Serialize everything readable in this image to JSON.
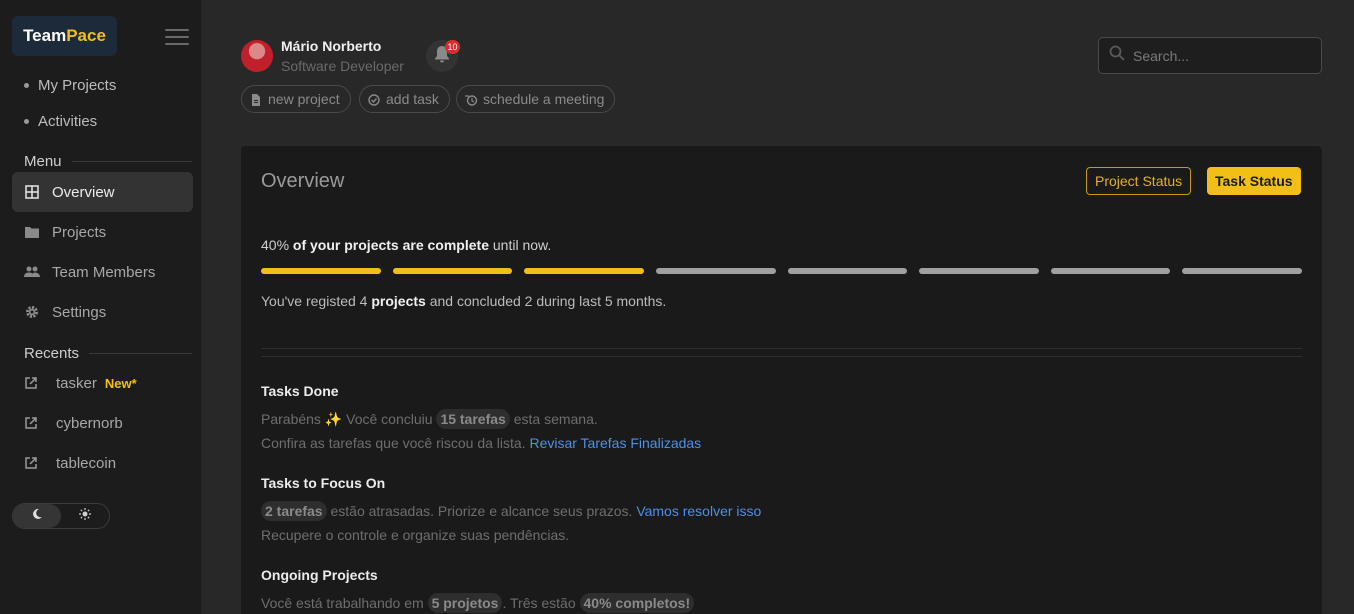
{
  "brand": {
    "name_part1": "Team",
    "name_part2": "Pace"
  },
  "sidebar": {
    "quick_links": [
      {
        "label": "My Projects"
      },
      {
        "label": "Activities"
      }
    ],
    "menu_label": "Menu",
    "menu_items": [
      {
        "label": "Overview",
        "icon": "grid-icon",
        "active": true
      },
      {
        "label": "Projects",
        "icon": "folder-icon"
      },
      {
        "label": "Team Members",
        "icon": "people-icon"
      },
      {
        "label": "Settings",
        "icon": "gear-icon"
      }
    ],
    "recents_label": "Recents",
    "recents": [
      {
        "label": "tasker",
        "badge": "New*"
      },
      {
        "label": "cybernorb"
      },
      {
        "label": "tablecoin"
      }
    ],
    "theme": {
      "options": [
        "moon-icon",
        "sun-icon"
      ],
      "active": "dark"
    }
  },
  "header": {
    "user": {
      "name": "Mário Norberto",
      "role": "Software Developer"
    },
    "notifications": {
      "count": "10"
    },
    "actions": [
      {
        "label": "new project",
        "icon": "file-icon"
      },
      {
        "label": "add task",
        "icon": "check-circle-icon"
      },
      {
        "label": "schedule a meeting",
        "icon": "calendar-icon"
      }
    ],
    "search": {
      "placeholder": "Search..."
    }
  },
  "overview": {
    "title": "Overview",
    "buttons": {
      "project_status": "Project Status",
      "task_status": "Task Status"
    },
    "progress": {
      "percent_text": "40%",
      "bold_text": "of your projects are complete",
      "suffix_text": "until now.",
      "segments_total": 8,
      "segments_filled": 3
    },
    "summary": {
      "prefix": "You've registed 4",
      "bold": "projects",
      "suffix": "and concluded 2 during last 5 months."
    },
    "tasks_done": {
      "title": "Tasks Done",
      "line1_prefix": "Parabéns ✨ Você concluiu",
      "line1_chip": "15 tarefas",
      "line1_suffix": "esta semana.",
      "line2_text": "Confira as tarefas que você riscou da lista.",
      "line2_link": "Revisar Tarefas Finalizadas"
    },
    "tasks_focus": {
      "title": "Tasks to Focus On",
      "line1_chip": "2 tarefas",
      "line1_text": "estão atrasadas. Priorize e alcance seus prazos.",
      "line1_link": "Vamos resolver isso",
      "line2_text": "Recupere o controle e organize suas pendências."
    },
    "ongoing": {
      "title": "Ongoing Projects",
      "line1_prefix": "Você está trabalhando em",
      "line1_chip1": "5 projetos",
      "line1_mid": ". Três estão",
      "line1_chip2": "40% completos!"
    }
  },
  "colors": {
    "accent": "#f2bf17",
    "link": "#4d90e6",
    "badge": "#d92d2d"
  }
}
